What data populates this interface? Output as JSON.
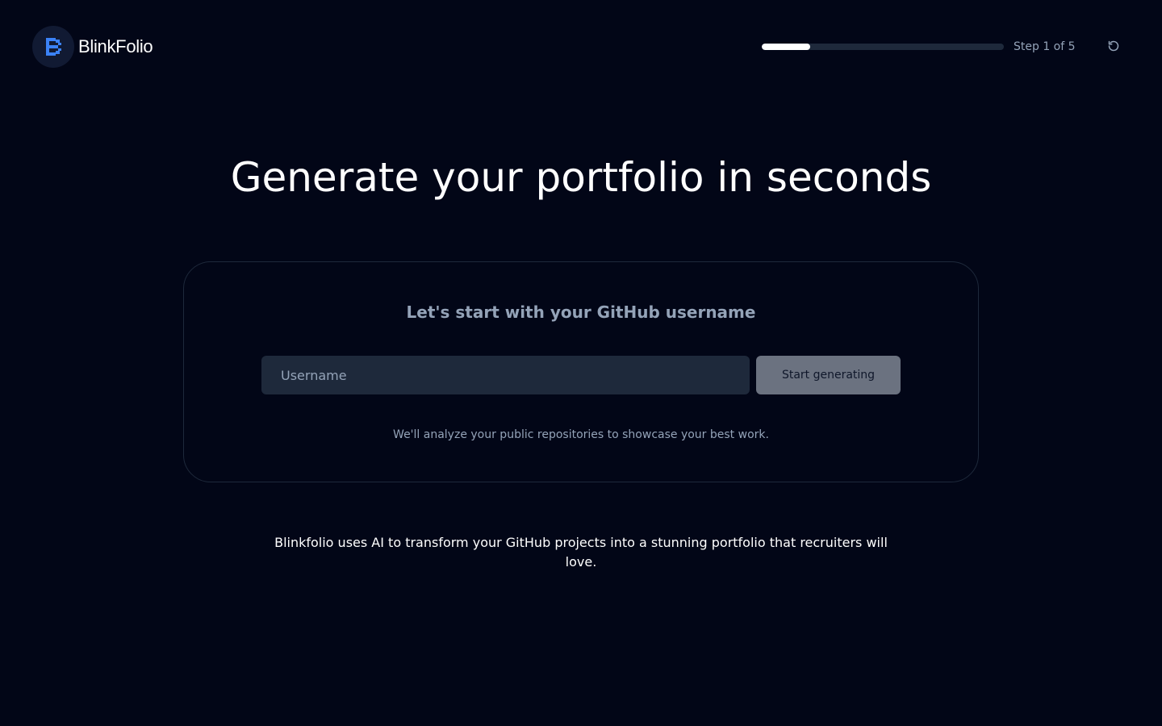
{
  "brand": {
    "name": "BlinkFolio",
    "logo_icon": "blinkfolio-logo-icon",
    "accent_color": "#3b82f6"
  },
  "progress": {
    "current_step": 1,
    "total_steps": 5,
    "fraction": 0.2,
    "label": "Step 1 of 5"
  },
  "header": {
    "reset_icon": "refresh-icon"
  },
  "hero": {
    "title": "Generate your portfolio in seconds"
  },
  "form": {
    "title": "Let's start with your GitHub username",
    "username_value": "",
    "username_placeholder": "Username",
    "submit_label": "Start generating",
    "hint": "We'll analyze your public repositories to showcase your best work."
  },
  "footer": {
    "blurb": "Blinkfolio uses AI to transform your GitHub projects into a stunning portfolio that recruiters will love."
  }
}
